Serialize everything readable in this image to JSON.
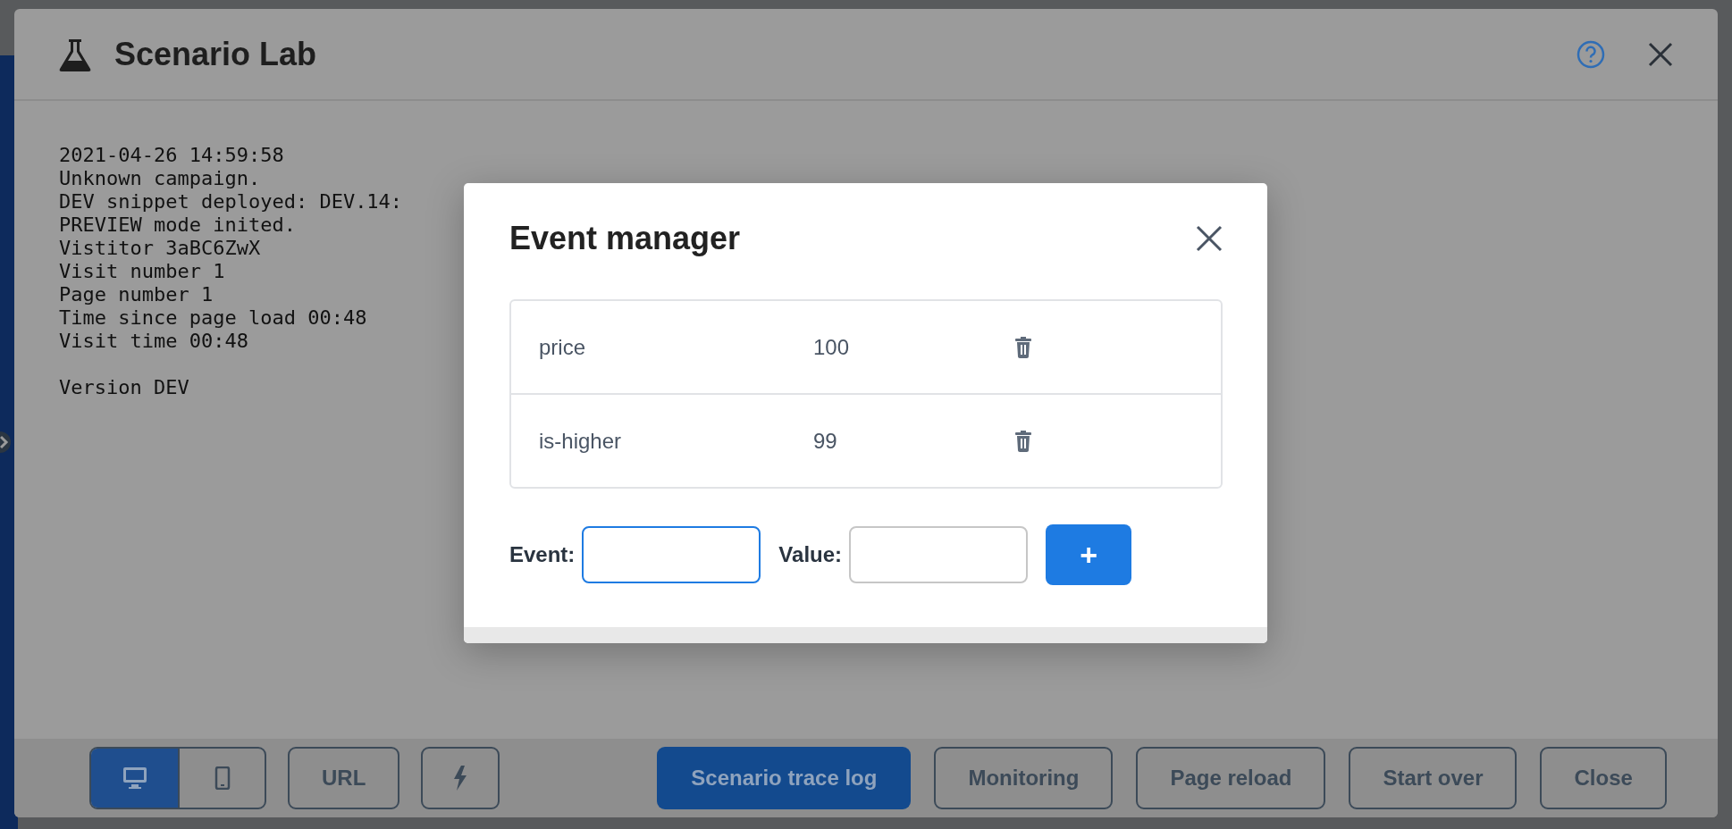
{
  "window": {
    "title": "Scenario Lab"
  },
  "log": {
    "lines": [
      "2021-04-26 14:59:58",
      "Unknown campaign.",
      "DEV snippet deployed: DEV.14:",
      "PREVIEW mode inited.",
      "Vistitor 3aBC6ZwX",
      "Visit number 1",
      "Page number 1",
      "Time since page load 00:48",
      "Visit time 00:48"
    ],
    "footer": "Version DEV"
  },
  "view_toggle": [
    {
      "kind": "desktop",
      "selected": true
    },
    {
      "kind": "tablet",
      "selected": false
    }
  ],
  "toolbar": [
    {
      "kind": "text",
      "label": "URL"
    },
    {
      "kind": "bolt"
    }
  ],
  "actions": [
    {
      "label": "Scenario trace log",
      "kind": "primary"
    },
    {
      "label": "Monitoring",
      "kind": "outline"
    },
    {
      "label": "Page reload",
      "kind": "outline"
    },
    {
      "label": "Start over",
      "kind": "outline"
    },
    {
      "label": "Close",
      "kind": "outline"
    }
  ],
  "dialog": {
    "title": "Event manager",
    "events": [
      {
        "name": "price",
        "value": "100"
      },
      {
        "name": "is-higher",
        "value": "99"
      }
    ],
    "form": {
      "event_label": "Event:",
      "event_focused": true,
      "value_label": "Value:",
      "value_focused": false,
      "add_label": "+"
    }
  }
}
